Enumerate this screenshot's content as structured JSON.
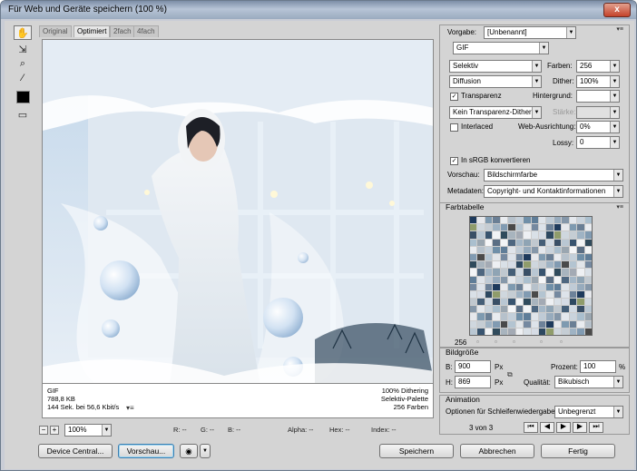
{
  "window": {
    "title": "Für Web und Geräte speichern (100 %)",
    "close_label": "x"
  },
  "tools": [
    {
      "name": "hand-tool-icon",
      "glyph": "✋"
    },
    {
      "name": "slice-select-icon",
      "glyph": "⇲"
    },
    {
      "name": "zoom-icon",
      "glyph": "⌕"
    },
    {
      "name": "eyedropper-icon",
      "glyph": "⁄"
    }
  ],
  "tabs": [
    "Original",
    "Optimiert",
    "2fach",
    "4fach"
  ],
  "active_tab": "Optimiert",
  "info": {
    "format": "GIF",
    "size": "788,8 KB",
    "time": "144 Sek. bei 56,6 Kbit/s",
    "dither": "100% Dithering",
    "palette": "Selektiv-Palette",
    "colors": "256 Farben",
    "menu": "▾≡"
  },
  "status": {
    "zoom": "100%",
    "r": "R: --",
    "g": "G: --",
    "b": "B: --",
    "alpha": "Alpha: --",
    "hex": "Hex: --",
    "index": "Index: --"
  },
  "buttons": {
    "device_central": "Device Central...",
    "preview": "Vorschau...",
    "save": "Speichern",
    "cancel": "Abbrechen",
    "done": "Fertig"
  },
  "settings": {
    "preset_label": "Vorgabe:",
    "preset_value": "[Unbenannt]",
    "format": "GIF",
    "reduction": "Selektiv",
    "colors_label": "Farben:",
    "colors_value": "256",
    "dither_algo": "Diffusion",
    "dither_label": "Dither:",
    "dither_value": "100%",
    "transparency_label": "Transparenz",
    "transparency_checked": true,
    "matte_label": "Hintergrund:",
    "trans_dither": "Kein Transparenz-Dither",
    "amount_label": "Stärke:",
    "interlaced_label": "Interlaced",
    "interlaced_checked": false,
    "websnap_label": "Web-Ausrichtung:",
    "websnap_value": "0%",
    "lossy_label": "Lossy:",
    "lossy_value": "0",
    "srgb_label": "In sRGB konvertieren",
    "srgb_checked": true,
    "preview_label": "Vorschau:",
    "preview_value": "Bildschirmfarbe",
    "metadata_label": "Metadaten:",
    "metadata_value": "Copyright- und Kontaktinformationen"
  },
  "color_table": {
    "title": "Farbtabelle",
    "count": "256",
    "menu": "▾≡"
  },
  "image_size": {
    "title": "Bildgröße",
    "w_label": "B:",
    "w_value": "900",
    "h_label": "H:",
    "h_value": "869",
    "unit": "Px",
    "percent_label": "Prozent:",
    "percent_value": "100",
    "percent_unit": "%",
    "quality_label": "Qualität:",
    "quality_value": "Bikubisch"
  },
  "animation": {
    "title": "Animation",
    "loop_label": "Optionen für Schleifenwiedergabe:",
    "loop_value": "Unbegrenzt",
    "frame": "3 von 3"
  },
  "palette": [
    "#1e3a5c",
    "#6f8fa8",
    "#c9d3dc",
    "#a4b7c7",
    "#38546f",
    "#d6dce5",
    "#4a4a4a",
    "#e6e8ec",
    "#5f7d98",
    "#aabfce",
    "#8fa4b4",
    "#f1f3f5",
    "#2d4860",
    "#b3c4d1",
    "#7e9ab0",
    "#dfe4ea",
    "#9aa6b0",
    "#c0c8cf",
    "#304b5c",
    "#8f9c6b",
    "#e1e5e9",
    "#6a7f95",
    "#bfcbd6",
    "#f5f6f8",
    "#455f78",
    "#a8b4be",
    "#cfd7de",
    "#7589a0",
    "#e9ecf0",
    "#97abbd",
    "#5a6e84",
    "#d1dae3",
    "#a3aab4",
    "#c5cdd4",
    "#dde3ea",
    "#b6c1cb",
    "#8597a9",
    "#f2f4f6",
    "#394f66",
    "#eef0f3",
    "#9fb3c4",
    "#6d8299",
    "#c3cfda",
    "#e4e8ed",
    "#4e6780",
    "#b9c7d3",
    "#d9e0e7",
    "#819bb2"
  ]
}
